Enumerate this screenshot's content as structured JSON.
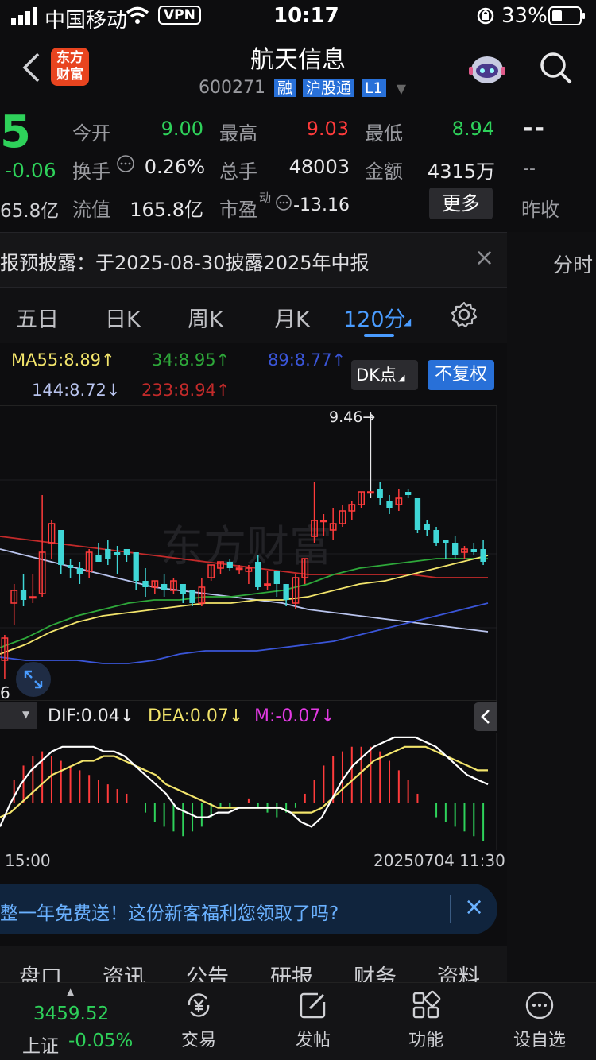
{
  "status_bar": {
    "carrier": "中国移动",
    "vpn": "VPN",
    "time": "10:17",
    "battery": "33%"
  },
  "header": {
    "title": "航天信息",
    "code": "600271",
    "badges": [
      "融",
      "沪股通",
      "L1"
    ]
  },
  "quote": {
    "price_partial": "5",
    "change": "-0.06",
    "market_cap_partial": "65.8亿",
    "items": [
      {
        "label": "今开",
        "value": "9.00",
        "color": "#2ed15a"
      },
      {
        "label": "最高",
        "value": "9.03",
        "color": "#ff3b3b"
      },
      {
        "label": "最低",
        "value": "8.94",
        "color": "#2ed15a"
      },
      {
        "label": "换手",
        "value": "0.26%",
        "color": "#e8e8ea"
      },
      {
        "label": "总手",
        "value": "48003",
        "color": "#e8e8ea"
      },
      {
        "label": "金额",
        "value": "4315万",
        "color": "#e8e8ea"
      },
      {
        "label": "流值",
        "value": "165.8亿",
        "color": "#e8e8ea"
      },
      {
        "label": "市盈",
        "value": "-13.16",
        "color": "#e8e8ea"
      }
    ],
    "pe_superscript": "动",
    "more_button": "更多",
    "right_dashes_1": "--",
    "right_dashes_2": "--",
    "right_label": "昨收"
  },
  "notice": {
    "text": "报预披露：于2025-08-30披露2025年中报",
    "close": "×"
  },
  "side_tab": "分时",
  "period_tabs": {
    "items": [
      "五日",
      "日K",
      "周K",
      "月K",
      "120分"
    ],
    "active": 4
  },
  "ma_lines": {
    "ma55": "MA55:8.89↑",
    "ma34": "34:8.95↑",
    "ma89": "89:8.77↑",
    "ma144": "144:8.72↓",
    "ma233": "233:8.94↑"
  },
  "chart_buttons": {
    "dk": "DK点",
    "adjust": "不复权"
  },
  "chart_annotations": {
    "high_label": "9.46→",
    "left_low_label": "6"
  },
  "watermark": "东方财富",
  "macd": {
    "selector": "",
    "dif": "DIF:0.04↓",
    "dea": "DEA:0.07↓",
    "m": "M:-0.07↓"
  },
  "time_axis": {
    "left": "15:00",
    "right": "20250704 11:30"
  },
  "banner": {
    "text": "整一年免费送！这份新客福利您领取了吗?",
    "close": "×"
  },
  "sub_tabs": [
    "盘口",
    "资讯",
    "公告",
    "研报",
    "财务",
    "资料"
  ],
  "bottom_nav": {
    "index_value": "3459.52",
    "index_name": "上证",
    "index_change": "-0.05%",
    "items": [
      {
        "label": "交易",
        "icon": "yen-exchange-icon"
      },
      {
        "label": "发帖",
        "icon": "edit-icon"
      },
      {
        "label": "功能",
        "icon": "grid-icon"
      },
      {
        "label": "设自选",
        "icon": "more-dots-icon"
      }
    ]
  },
  "colors": {
    "up": "#ff3b3b",
    "down": "#2ed15a",
    "accent": "#4a9cff",
    "candle_down": "#3fd6d6",
    "ma55": "#f2e46b",
    "ma34": "#2ea83a",
    "ma89": "#3a55d8",
    "ma144": "#b9c4ee",
    "ma233": "#c22a2a",
    "dif": "#ffffff",
    "dea": "#f2e46b",
    "m": "#e33ae3"
  },
  "chart_data": {
    "type": "candlestick",
    "candles": [
      {
        "o": 8.68,
        "h": 8.76,
        "l": 8.62,
        "c": 8.75
      },
      {
        "o": 8.86,
        "h": 8.92,
        "l": 8.79,
        "c": 8.9
      },
      {
        "o": 8.9,
        "h": 8.95,
        "l": 8.85,
        "c": 8.87
      },
      {
        "o": 8.88,
        "h": 8.95,
        "l": 8.86,
        "c": 8.88
      },
      {
        "o": 8.89,
        "h": 9.2,
        "l": 8.88,
        "c": 9.02
      },
      {
        "o": 9.05,
        "h": 9.12,
        "l": 9.0,
        "c": 9.11
      },
      {
        "o": 9.09,
        "h": 9.09,
        "l": 8.95,
        "c": 8.98
      },
      {
        "o": 8.98,
        "h": 9.0,
        "l": 8.94,
        "c": 8.97
      },
      {
        "o": 8.97,
        "h": 8.99,
        "l": 8.92,
        "c": 8.95
      },
      {
        "o": 8.96,
        "h": 9.03,
        "l": 8.94,
        "c": 9.02
      },
      {
        "o": 9.01,
        "h": 9.05,
        "l": 8.99,
        "c": 8.99
      },
      {
        "o": 9.03,
        "h": 9.06,
        "l": 8.98,
        "c": 9.0
      },
      {
        "o": 9.02,
        "h": 9.04,
        "l": 8.95,
        "c": 9.01
      },
      {
        "o": 9.03,
        "h": 9.03,
        "l": 8.99,
        "c": 9.01
      },
      {
        "o": 9.02,
        "h": 9.02,
        "l": 8.9,
        "c": 8.93
      },
      {
        "o": 8.93,
        "h": 8.97,
        "l": 8.88,
        "c": 8.91
      },
      {
        "o": 8.91,
        "h": 8.93,
        "l": 8.89,
        "c": 8.93
      },
      {
        "o": 8.92,
        "h": 8.95,
        "l": 8.88,
        "c": 8.9
      },
      {
        "o": 8.9,
        "h": 8.94,
        "l": 8.89,
        "c": 8.93
      },
      {
        "o": 8.92,
        "h": 8.92,
        "l": 8.86,
        "c": 8.89
      },
      {
        "o": 8.9,
        "h": 8.9,
        "l": 8.85,
        "c": 8.86
      },
      {
        "o": 8.86,
        "h": 8.94,
        "l": 8.85,
        "c": 8.91
      },
      {
        "o": 8.94,
        "h": 8.98,
        "l": 8.93,
        "c": 8.98
      },
      {
        "o": 8.97,
        "h": 8.99,
        "l": 8.95,
        "c": 8.99
      },
      {
        "o": 8.99,
        "h": 9.0,
        "l": 8.96,
        "c": 8.97
      },
      {
        "o": 8.97,
        "h": 8.98,
        "l": 8.95,
        "c": 8.97
      },
      {
        "o": 8.96,
        "h": 8.98,
        "l": 8.92,
        "c": 8.97
      },
      {
        "o": 8.99,
        "h": 9.01,
        "l": 8.9,
        "c": 8.91
      },
      {
        "o": 8.92,
        "h": 8.96,
        "l": 8.9,
        "c": 8.92
      },
      {
        "o": 8.96,
        "h": 8.96,
        "l": 8.88,
        "c": 8.92
      },
      {
        "o": 8.92,
        "h": 8.92,
        "l": 8.85,
        "c": 8.87
      },
      {
        "o": 8.86,
        "h": 8.95,
        "l": 8.84,
        "c": 8.94
      },
      {
        "o": 8.94,
        "h": 9.0,
        "l": 8.92,
        "c": 9.0
      },
      {
        "o": 9.07,
        "h": 9.24,
        "l": 9.05,
        "c": 9.12
      },
      {
        "o": 9.12,
        "h": 9.14,
        "l": 9.07,
        "c": 9.12
      },
      {
        "o": 9.09,
        "h": 9.16,
        "l": 9.06,
        "c": 9.11
      },
      {
        "o": 9.11,
        "h": 9.17,
        "l": 9.1,
        "c": 9.15
      },
      {
        "o": 9.15,
        "h": 9.18,
        "l": 9.12,
        "c": 9.17
      },
      {
        "o": 9.17,
        "h": 9.21,
        "l": 9.16,
        "c": 9.21
      },
      {
        "o": 9.21,
        "h": 9.46,
        "l": 9.19,
        "c": 9.21
      },
      {
        "o": 9.22,
        "h": 9.24,
        "l": 9.17,
        "c": 9.19
      },
      {
        "o": 9.18,
        "h": 9.2,
        "l": 9.14,
        "c": 9.16
      },
      {
        "o": 9.17,
        "h": 9.22,
        "l": 9.15,
        "c": 9.19
      },
      {
        "o": 9.21,
        "h": 9.22,
        "l": 9.19,
        "c": 9.2
      },
      {
        "o": 9.19,
        "h": 9.19,
        "l": 9.08,
        "c": 9.09
      },
      {
        "o": 9.11,
        "h": 9.12,
        "l": 9.07,
        "c": 9.09
      },
      {
        "o": 9.09,
        "h": 9.1,
        "l": 9.04,
        "c": 9.05
      },
      {
        "o": 9.06,
        "h": 9.06,
        "l": 9.0,
        "c": 9.05
      },
      {
        "o": 9.05,
        "h": 9.07,
        "l": 9.0,
        "c": 9.01
      },
      {
        "o": 9.02,
        "h": 9.04,
        "l": 9.0,
        "c": 9.03
      },
      {
        "o": 9.03,
        "h": 9.05,
        "l": 9.01,
        "c": 9.02
      },
      {
        "o": 9.03,
        "h": 9.06,
        "l": 8.98,
        "c": 8.99
      }
    ],
    "ma233": [
      9.07,
      9.06,
      9.05,
      9.04,
      9.03,
      9.02,
      9.01,
      9.0,
      8.99,
      8.98,
      8.97,
      8.96,
      8.95,
      8.95,
      8.95,
      8.95,
      8.95,
      8.94,
      8.94,
      8.94
    ],
    "ma144": [
      9.03,
      9.01,
      8.99,
      8.97,
      8.95,
      8.93,
      8.91,
      8.9,
      8.89,
      8.88,
      8.87,
      8.86,
      8.84,
      8.83,
      8.82,
      8.81,
      8.8,
      8.79,
      8.78,
      8.77
    ],
    "ma55": [
      8.7,
      8.73,
      8.77,
      8.8,
      8.82,
      8.83,
      8.84,
      8.85,
      8.86,
      8.86,
      8.87,
      8.87,
      8.88,
      8.9,
      8.92,
      8.93,
      8.95,
      8.97,
      8.99,
      9.01
    ],
    "ma34": [
      8.72,
      8.75,
      8.79,
      8.82,
      8.84,
      8.86,
      8.87,
      8.87,
      8.88,
      8.88,
      8.89,
      8.9,
      8.92,
      8.95,
      8.97,
      8.98,
      8.99,
      9.0,
      9.0,
      9.0
    ],
    "ma89": [
      8.69,
      8.68,
      8.68,
      8.68,
      8.67,
      8.67,
      8.68,
      8.7,
      8.71,
      8.71,
      8.71,
      8.72,
      8.73,
      8.74,
      8.76,
      8.78,
      8.8,
      8.82,
      8.84,
      8.86
    ],
    "macd_hist": [
      0.0,
      0.05,
      0.08,
      0.1,
      0.11,
      0.1,
      0.09,
      0.08,
      0.07,
      0.06,
      0.05,
      0.04,
      0.03,
      0.02,
      0.0,
      -0.02,
      -0.04,
      -0.05,
      -0.06,
      -0.07,
      -0.06,
      -0.05,
      -0.03,
      -0.01,
      -0.01,
      0.0,
      0.01,
      -0.01,
      -0.02,
      -0.03,
      -0.02,
      -0.01,
      0.02,
      0.05,
      0.08,
      0.1,
      0.11,
      0.12,
      0.12,
      0.12,
      0.11,
      0.09,
      0.07,
      0.05,
      0.02,
      0.0,
      -0.03,
      -0.04,
      -0.05,
      -0.06,
      -0.07,
      -0.08
    ],
    "dif": [
      -0.05,
      0.0,
      0.04,
      0.07,
      0.09,
      0.11,
      0.12,
      0.12,
      0.12,
      0.12,
      0.11,
      0.11,
      0.1,
      0.08,
      0.06,
      0.04,
      0.02,
      -0.01,
      -0.02,
      -0.03,
      -0.03,
      -0.02,
      -0.02,
      -0.01,
      -0.01,
      -0.01,
      -0.01,
      -0.01,
      -0.02,
      -0.04,
      -0.05,
      -0.03,
      0.01,
      0.05,
      0.08,
      0.1,
      0.12,
      0.13,
      0.14,
      0.14,
      0.14,
      0.13,
      0.12,
      0.1,
      0.08,
      0.06,
      0.05,
      0.04
    ],
    "dea": [
      -0.03,
      -0.02,
      0.0,
      0.02,
      0.04,
      0.06,
      0.07,
      0.08,
      0.09,
      0.09,
      0.1,
      0.1,
      0.09,
      0.08,
      0.07,
      0.06,
      0.04,
      0.03,
      0.02,
      0.01,
      0.0,
      -0.01,
      -0.01,
      -0.01,
      -0.01,
      -0.01,
      -0.01,
      -0.01,
      -0.02,
      -0.02,
      -0.02,
      -0.01,
      0.01,
      0.03,
      0.05,
      0.07,
      0.09,
      0.1,
      0.11,
      0.12,
      0.12,
      0.12,
      0.11,
      0.1,
      0.09,
      0.08,
      0.07,
      0.07
    ]
  }
}
